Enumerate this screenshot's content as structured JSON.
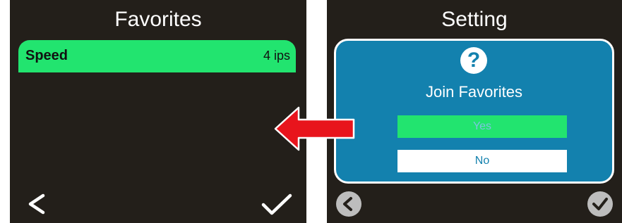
{
  "left_screen": {
    "title": "Favorites",
    "items": [
      {
        "label": "Speed",
        "value": "4 ips"
      }
    ],
    "back_icon": "chevron-left-icon",
    "confirm_icon": "checkmark-icon"
  },
  "right_screen": {
    "title": "Setting",
    "dialog": {
      "icon": "question-icon",
      "icon_glyph": "?",
      "title": "Join Favorites",
      "yes_label": "Yes",
      "no_label": "No"
    },
    "back_icon": "circle-chevron-left-icon",
    "confirm_icon": "circle-check-icon"
  },
  "colors": {
    "screen_bg": "#231f1a",
    "highlight_green": "#22e46f",
    "dialog_blue": "#1381ae",
    "arrow_red": "#e8141c",
    "button_gray": "#bdbdbd"
  }
}
